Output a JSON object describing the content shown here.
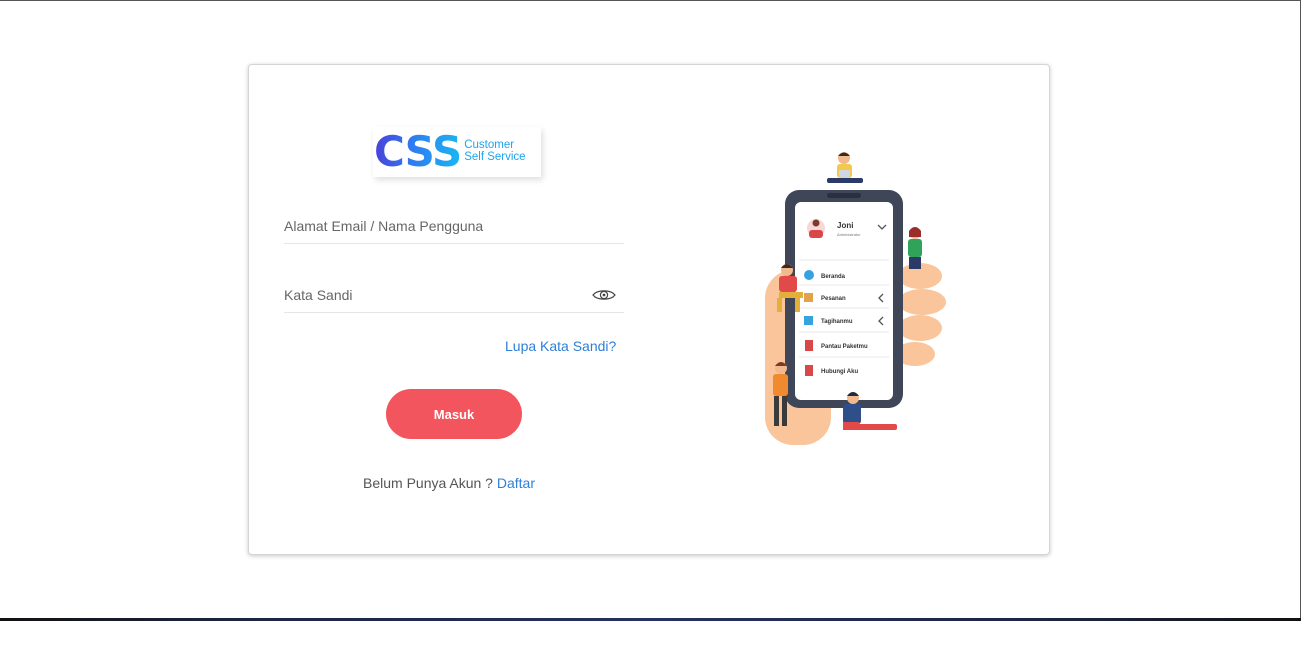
{
  "brand": {
    "logo_mark": "CSS",
    "logo_line1": "Customer",
    "logo_line2": "Self Service"
  },
  "login": {
    "email_placeholder": "Alamat Email / Nama Pengguna",
    "email_value": "",
    "password_placeholder": "Kata Sandi",
    "password_value": "",
    "forgot_link": "Lupa Kata Sandi?",
    "submit_label": "Masuk",
    "register_prompt": "Belum Punya Akun ?",
    "register_link": "Daftar"
  },
  "illustration": {
    "user_name": "Joni",
    "user_role": "Administrator",
    "menu": [
      "Beranda",
      "Pesanan",
      "Tagihanmu",
      "Pantau Paketmu",
      "Hubungi Aku"
    ]
  },
  "colors": {
    "primary_button": "#f2555d",
    "link": "#2e7fd8",
    "logo_gradient_start": "#4a3fd8",
    "logo_gradient_end": "#19b7f2"
  },
  "icons": {
    "password_toggle": "eye-icon"
  }
}
